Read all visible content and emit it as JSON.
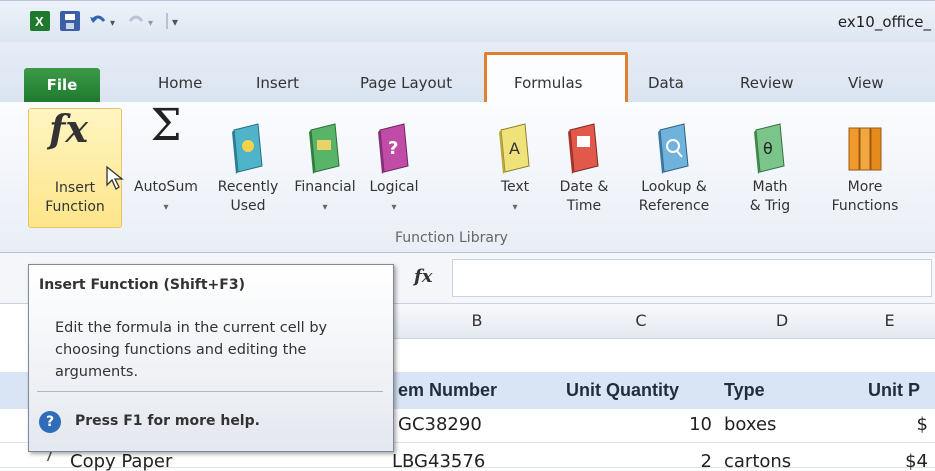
{
  "window": {
    "title": "ex10_office_"
  },
  "tabs": [
    {
      "label": "File"
    },
    {
      "label": "Home"
    },
    {
      "label": "Insert"
    },
    {
      "label": "Page Layout"
    },
    {
      "label": "Formulas"
    },
    {
      "label": "Data"
    },
    {
      "label": "Review"
    },
    {
      "label": "View"
    }
  ],
  "ribbon": {
    "buttons": [
      {
        "label": "Insert\nFunction",
        "icon": "fx-icon"
      },
      {
        "label": "AutoSum",
        "icon": "sigma-icon"
      },
      {
        "label": "Recently\nUsed",
        "icon": "book-star-icon"
      },
      {
        "label": "Financial",
        "icon": "book-money-icon"
      },
      {
        "label": "Logical",
        "icon": "book-question-icon"
      },
      {
        "label": "Text",
        "icon": "book-a-icon"
      },
      {
        "label": "Date &\nTime",
        "icon": "book-calendar-icon"
      },
      {
        "label": "Lookup &\nReference",
        "icon": "book-magnifier-icon"
      },
      {
        "label": "Math\n& Trig",
        "icon": "book-theta-icon"
      },
      {
        "label": "More\nFunctions",
        "icon": "books-icon"
      }
    ],
    "group_label": "Function Library"
  },
  "formula_bar": {
    "fx_label": "fx",
    "value": ""
  },
  "grid": {
    "columns": [
      "B",
      "C",
      "D",
      "E"
    ],
    "header_row": [
      "em Number",
      "Unit Quantity",
      "Type",
      "Unit P"
    ],
    "rows": [
      {
        "row": "",
        "cells": [
          "GC38290",
          "10",
          "boxes",
          "$"
        ]
      },
      {
        "row": "7",
        "first": "Copy Paper",
        "cells": [
          "LBG43576",
          "2",
          "cartons",
          "$4"
        ]
      }
    ]
  },
  "tooltip": {
    "title": "Insert Function (Shift+F3)",
    "body": "Edit the formula in the current cell by choosing functions and editing the arguments.",
    "help": "Press F1 for more help."
  },
  "colors": {
    "file_tab": "#1f7a2e",
    "highlight": "#e0802c",
    "selected_button": "#fde58a"
  }
}
